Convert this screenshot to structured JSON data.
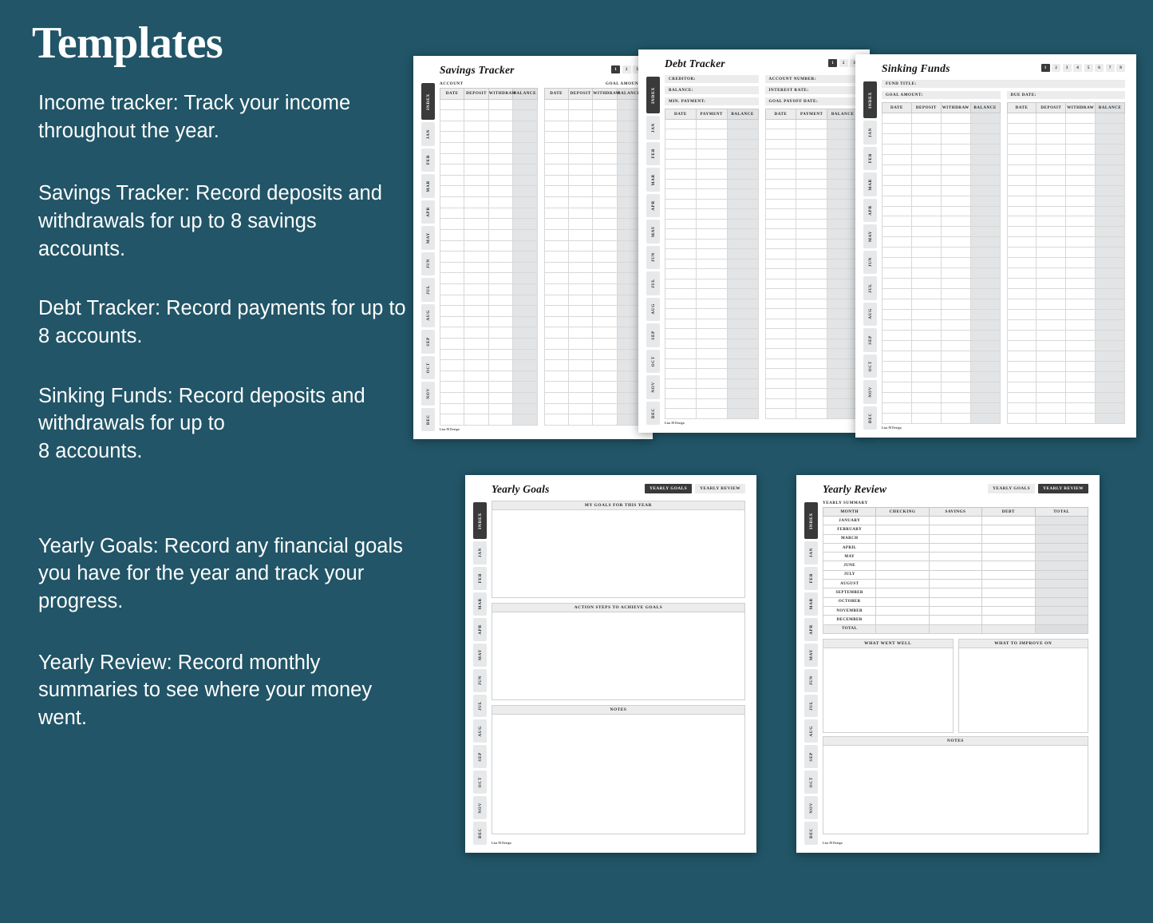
{
  "headline": "Templates",
  "paragraphs": [
    "Income tracker: Track your income\nthroughout the year.",
    "Savings Tracker: Record deposits and withdrawals for up to 8 savings accounts.",
    "Debt Tracker: Record payments for up to 8 accounts.",
    "Sinking Funds:  Record deposits and withdrawals for up to\n8 accounts.",
    "Yearly Goals: Record any financial goals you have for the year and track your progress.",
    "Yearly Review: Record monthly summaries to see where your money went."
  ],
  "colors": {
    "background": "#215567",
    "sheet": "#ffffff",
    "tab_active": "#3a3a3a",
    "tab_inactive": "#ececec",
    "shade_column": "#e2e4e6"
  },
  "rail": {
    "index_label": "INDEX",
    "months": [
      "JAN",
      "FEB",
      "MAR",
      "APR",
      "MAY",
      "JUN",
      "JUL",
      "AUG",
      "SEP",
      "OCT",
      "NOV",
      "DEC"
    ]
  },
  "footer_mark": "Lisa M Design",
  "savings_tracker": {
    "title": "Savings Tracker",
    "page_tabs": [
      "1",
      "2",
      "3"
    ],
    "active_tab": "1",
    "caption_left": "ACCOUNT",
    "caption_right": "GOAL AMOUNT",
    "columns": [
      "DATE",
      "DEPOSIT",
      "WITHDRAW",
      "BALANCE"
    ],
    "shaded_column": "BALANCE",
    "row_count": 30
  },
  "debt_tracker": {
    "title": "Debt Tracker",
    "page_tabs": [
      "1",
      "2",
      "3"
    ],
    "active_tab": "1",
    "fields": [
      {
        "label": "CREDITOR:",
        "value": ""
      },
      {
        "label": "ACCOUNT NUMBER:",
        "value": ""
      },
      {
        "label": "BALANCE:",
        "value": ""
      },
      {
        "label": "INTEREST RATE:",
        "value": ""
      },
      {
        "label": "MIN. PAYMENT:",
        "value": ""
      },
      {
        "label": "GOAL PAYOFF DATE:",
        "value": ""
      }
    ],
    "columns": [
      "DATE",
      "PAYMENT",
      "BALANCE"
    ],
    "shaded_column": "BALANCE",
    "row_count": 30
  },
  "sinking_funds": {
    "title": "Sinking Funds",
    "page_tabs": [
      "1",
      "2",
      "3",
      "4",
      "5",
      "6",
      "7",
      "8"
    ],
    "active_tab": "1",
    "fields": [
      {
        "label": "FUND TITLE:",
        "value": ""
      },
      {
        "label": "GOAL AMOUNT:",
        "value": ""
      },
      {
        "label": "DUE DATE:",
        "value": ""
      }
    ],
    "columns": [
      "DATE",
      "DEPOSIT",
      "WITHDRAW",
      "BALANCE"
    ],
    "shaded_column": "BALANCE",
    "row_count": 30
  },
  "yearly_goals": {
    "title": "Yearly Goals",
    "tabs": [
      {
        "label": "YEARLY GOALS",
        "active": true
      },
      {
        "label": "YEARLY REVIEW",
        "active": false
      }
    ],
    "sections": [
      {
        "heading": "MY GOALS FOR THIS YEAR",
        "content": ""
      },
      {
        "heading": "ACTION STEPS TO ACHIEVE GOALS",
        "content": ""
      },
      {
        "heading": "NOTES",
        "content": ""
      }
    ]
  },
  "yearly_review": {
    "title": "Yearly Review",
    "tabs": [
      {
        "label": "YEARLY GOALS",
        "active": false
      },
      {
        "label": "YEARLY REVIEW",
        "active": true
      }
    ],
    "summary_caption": "YEARLY SUMMARY",
    "summary_columns": [
      "MONTH",
      "CHECKING",
      "SAVINGS",
      "DEBT",
      "TOTAL"
    ],
    "shaded_column": "TOTAL",
    "summary_rows": [
      {
        "month": "JANUARY",
        "checking": "",
        "savings": "",
        "debt": "",
        "total": ""
      },
      {
        "month": "FEBRUARY",
        "checking": "",
        "savings": "",
        "debt": "",
        "total": ""
      },
      {
        "month": "MARCH",
        "checking": "",
        "savings": "",
        "debt": "",
        "total": ""
      },
      {
        "month": "APRIL",
        "checking": "",
        "savings": "",
        "debt": "",
        "total": ""
      },
      {
        "month": "MAY",
        "checking": "",
        "savings": "",
        "debt": "",
        "total": ""
      },
      {
        "month": "JUNE",
        "checking": "",
        "savings": "",
        "debt": "",
        "total": ""
      },
      {
        "month": "JULY",
        "checking": "",
        "savings": "",
        "debt": "",
        "total": ""
      },
      {
        "month": "AUGUST",
        "checking": "",
        "savings": "",
        "debt": "",
        "total": ""
      },
      {
        "month": "SEPTEMBER",
        "checking": "",
        "savings": "",
        "debt": "",
        "total": ""
      },
      {
        "month": "OCTOBER",
        "checking": "",
        "savings": "",
        "debt": "",
        "total": ""
      },
      {
        "month": "NOVEMBER",
        "checking": "",
        "savings": "",
        "debt": "",
        "total": ""
      },
      {
        "month": "DECEMBER",
        "checking": "",
        "savings": "",
        "debt": "",
        "total": ""
      },
      {
        "month": "TOTAL",
        "checking": "",
        "savings": "",
        "debt": "",
        "total": ""
      }
    ],
    "review_boxes": [
      {
        "heading": "WHAT WENT WELL",
        "content": ""
      },
      {
        "heading": "WHAT TO IMPROVE ON",
        "content": ""
      }
    ],
    "notes_heading": "NOTES"
  }
}
